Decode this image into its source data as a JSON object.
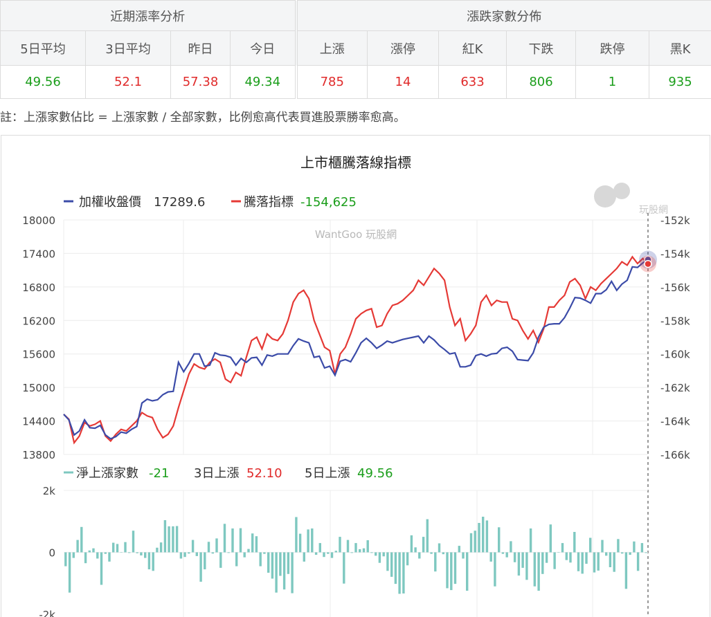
{
  "table": {
    "group_left": "近期漲率分析",
    "group_right": "漲跌家數分佈",
    "headers": [
      "5日平均",
      "3日平均",
      "昨日",
      "今日",
      "上漲",
      "漲停",
      "紅K",
      "下跌",
      "跌停",
      "黑K"
    ],
    "values": [
      "49.56",
      "52.1",
      "57.38",
      "49.34",
      "785",
      "14",
      "633",
      "806",
      "1",
      "935"
    ],
    "value_colors": [
      "#1b9e1b",
      "#e02a2a",
      "#e02a2a",
      "#1b9e1b",
      "#e02a2a",
      "#e02a2a",
      "#e02a2a",
      "#1b9e1b",
      "#1b9e1b",
      "#1b9e1b"
    ]
  },
  "note": "註：上漲家數佔比 = 上漲家數 / 全部家數，比例愈高代表買進股票勝率愈高。",
  "colors": {
    "index": "#3b4ba8",
    "adl": "#e53935",
    "bar": "#7ec8c0",
    "up": "#e02a2a",
    "down": "#1b9e1b"
  },
  "watermark": {
    "text": "WantGoo 玩股網",
    "logo_text": "玩股網"
  },
  "chart_data": [
    {
      "type": "line",
      "title": "上市櫃騰落線指標",
      "y_left": {
        "min": 13800,
        "max": 18000,
        "ticks": [
          "18000",
          "17400",
          "16800",
          "16200",
          "15600",
          "15000",
          "14400",
          "13800"
        ]
      },
      "y_right": {
        "min": -166000,
        "max": -152000,
        "ticks": [
          "-152k",
          "-154k",
          "-156k",
          "-158k",
          "-160k",
          "-162k",
          "-164k",
          "-166k"
        ]
      },
      "grid": true,
      "series": [
        {
          "name": "加權收盤價",
          "latest": "17289.6",
          "axis": "left",
          "values": [
            14520,
            14420,
            14150,
            14220,
            14420,
            14280,
            14270,
            14320,
            14150,
            14080,
            14120,
            14200,
            14180,
            14250,
            14300,
            14720,
            14790,
            14760,
            14780,
            14870,
            14920,
            14930,
            15450,
            15280,
            15430,
            15600,
            15600,
            15380,
            15400,
            15620,
            15580,
            15570,
            15540,
            15400,
            15520,
            15450,
            15530,
            15540,
            15400,
            15580,
            15560,
            15600,
            15600,
            15600,
            15750,
            15870,
            15830,
            15800,
            15540,
            15560,
            15350,
            15380,
            15220,
            15470,
            15500,
            15460,
            15620,
            15800,
            15880,
            15800,
            15700,
            15760,
            15830,
            15800,
            15830,
            15860,
            15880,
            15900,
            15920,
            15800,
            15920,
            15850,
            15750,
            15680,
            15600,
            15620,
            15370,
            15370,
            15400,
            15570,
            15600,
            15560,
            15600,
            15610,
            15700,
            15720,
            15650,
            15500,
            15490,
            15480,
            15620,
            15900,
            16080,
            16130,
            16140,
            16140,
            16250,
            16420,
            16610,
            16600,
            16560,
            16510,
            16680,
            16680,
            16750,
            16900,
            16740,
            16850,
            16920,
            17160,
            17150,
            17230,
            17289.6
          ]
        },
        {
          "name": "騰落指標",
          "latest": "-154,625",
          "axis": "right",
          "values": [
            -163600,
            -163900,
            -165300,
            -164900,
            -164100,
            -164300,
            -164200,
            -164000,
            -164900,
            -165200,
            -164800,
            -164500,
            -164600,
            -164300,
            -164000,
            -163500,
            -163700,
            -163800,
            -164500,
            -165000,
            -164800,
            -164300,
            -163200,
            -162200,
            -161200,
            -160600,
            -160800,
            -160900,
            -160500,
            -160300,
            -160500,
            -161500,
            -161700,
            -161100,
            -161300,
            -160200,
            -159200,
            -159000,
            -159700,
            -158800,
            -159100,
            -159200,
            -158800,
            -158000,
            -156900,
            -156400,
            -156200,
            -156700,
            -158000,
            -158800,
            -159600,
            -159800,
            -161200,
            -160000,
            -159600,
            -158800,
            -157900,
            -157600,
            -157400,
            -157300,
            -158400,
            -158300,
            -157600,
            -157100,
            -157000,
            -156800,
            -156500,
            -156200,
            -155600,
            -155900,
            -155400,
            -154900,
            -155200,
            -155600,
            -157200,
            -158300,
            -157900,
            -159200,
            -158800,
            -158300,
            -156900,
            -156500,
            -157100,
            -156800,
            -156900,
            -156900,
            -157900,
            -158000,
            -158600,
            -159100,
            -158600,
            -159300,
            -158500,
            -157200,
            -157200,
            -156800,
            -156500,
            -155700,
            -155500,
            -155900,
            -156700,
            -156000,
            -156200,
            -155800,
            -155500,
            -155200,
            -154900,
            -154500,
            -154700,
            -154200,
            -154600,
            -154300,
            -154625
          ]
        }
      ]
    },
    {
      "type": "bar",
      "y": {
        "min": -2000,
        "max": 2000,
        "ticks": [
          "2k",
          "0",
          "-2k"
        ]
      },
      "legend": [
        {
          "name": "淨上漲家數",
          "value": "-21"
        },
        {
          "name": "3日上漲",
          "value": "52.10"
        },
        {
          "name": "5日上漲",
          "value": "49.56"
        }
      ],
      "series": [
        {
          "name": "淨上漲家數",
          "values": [
            -450,
            -1300,
            -180,
            400,
            820,
            -350,
            60,
            130,
            -200,
            -1050,
            -50,
            -300,
            310,
            270,
            -10,
            330,
            -20,
            700,
            -30,
            -100,
            -180,
            -550,
            -600,
            150,
            320,
            1040,
            840,
            840,
            850,
            -200,
            -150,
            -40,
            400,
            -120,
            -950,
            -550,
            340,
            -40,
            450,
            -500,
            920,
            -20,
            770,
            -450,
            780,
            -160,
            110,
            610,
            520,
            -450,
            -50,
            -660,
            -850,
            -1300,
            -760,
            -1200,
            -700,
            -1320,
            1140,
            600,
            -300,
            740,
            770,
            -80,
            300,
            -150,
            -50,
            -180,
            50,
            500,
            -1010,
            400,
            -20,
            300,
            100,
            130,
            390,
            -20,
            -110,
            -340,
            -130,
            -600,
            -790,
            -1020,
            -1340,
            -1330,
            -420,
            550,
            160,
            -200,
            500,
            1070,
            -50,
            -620,
            290,
            -60,
            -1160,
            -1220,
            -1020,
            210,
            -200,
            -1240,
            620,
            700,
            950,
            1150,
            1030,
            -300,
            -1100,
            810,
            -50,
            -160,
            360,
            -320,
            -750,
            -500,
            -890,
            770,
            -1100,
            -1240,
            -700,
            -340,
            900,
            -540,
            -10,
            300,
            -250,
            -330,
            660,
            -610,
            -690,
            -370,
            470,
            -650,
            -590,
            400,
            -110,
            -480,
            -630,
            430,
            -40,
            -1180,
            -80,
            350,
            -600,
            300,
            -21
          ]
        }
      ]
    }
  ]
}
